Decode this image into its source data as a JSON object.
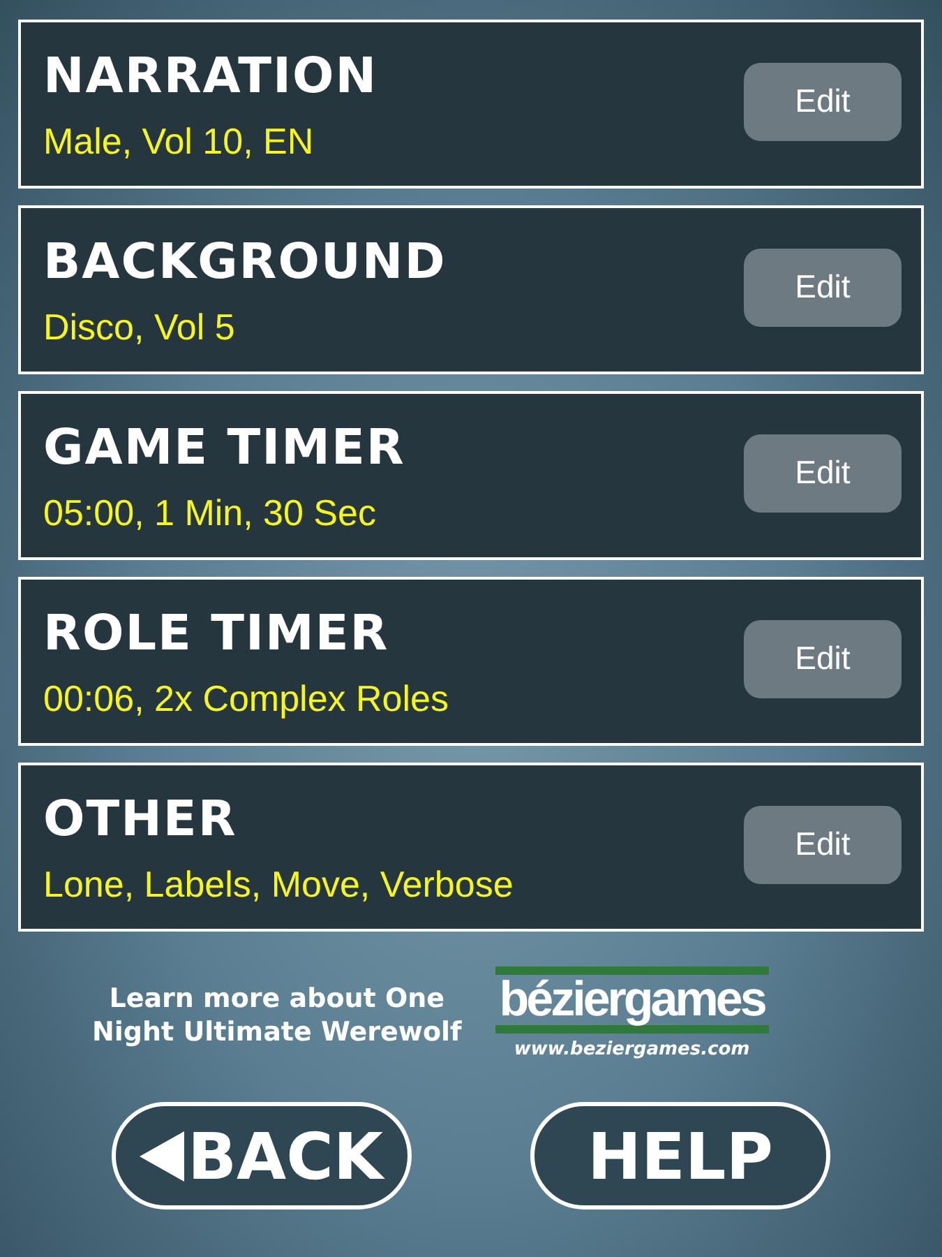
{
  "settings": [
    {
      "title": "NARRATION",
      "summary": "Male, Vol 10, EN",
      "button": "Edit"
    },
    {
      "title": "BACKGROUND",
      "summary": "Disco, Vol 5",
      "button": "Edit"
    },
    {
      "title": "GAME TIMER",
      "summary": "05:00, 1 Min, 30 Sec",
      "button": "Edit"
    },
    {
      "title": "ROLE TIMER",
      "summary": "00:06, 2x Complex Roles",
      "button": "Edit"
    },
    {
      "title": "OTHER",
      "summary": "Lone, Labels, Move, Verbose",
      "button": "Edit"
    }
  ],
  "promo": {
    "lines": [
      "Learn more about One",
      "Night Ultimate Werewolf"
    ]
  },
  "logo": {
    "wordmark": "béziergames",
    "url": "www.beziergames.com"
  },
  "buttons": [
    {
      "label": "BACK",
      "kind": "back"
    },
    {
      "label": "HELP",
      "kind": "help"
    }
  ]
}
